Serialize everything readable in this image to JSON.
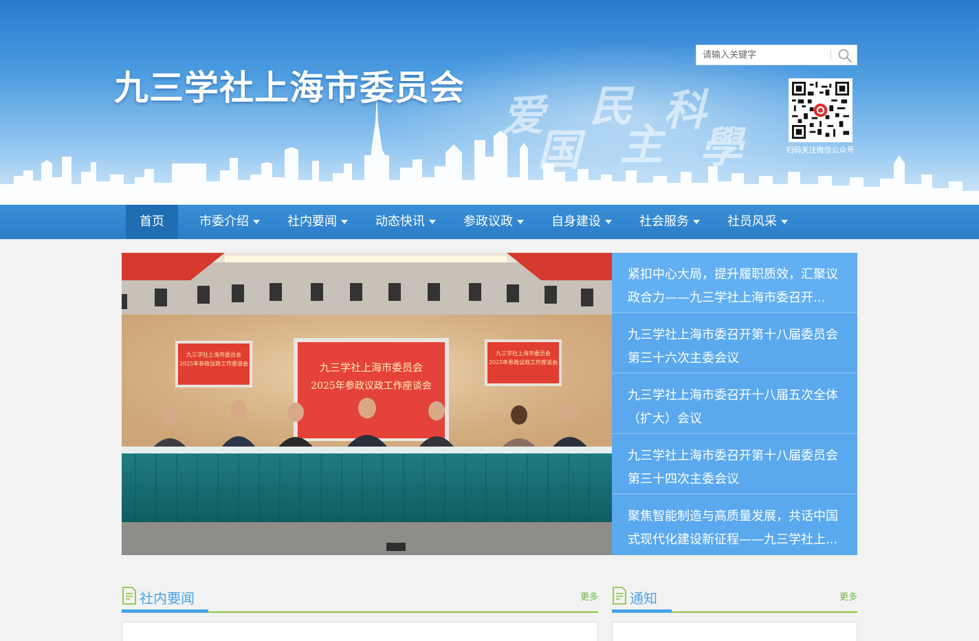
{
  "header": {
    "site_title": "九三学社上海市委员会",
    "slogan": [
      "爱",
      "国",
      "民",
      "主",
      "科",
      "學"
    ],
    "search_placeholder": "请输入关键字",
    "qr_caption": "扫码关注微信公众号"
  },
  "nav": {
    "items": [
      {
        "label": "首页",
        "active": true,
        "dropdown": false
      },
      {
        "label": "市委介绍",
        "dropdown": true
      },
      {
        "label": "社内要闻",
        "dropdown": true
      },
      {
        "label": "动态快讯",
        "dropdown": true
      },
      {
        "label": "参政议政",
        "dropdown": true
      },
      {
        "label": "自身建设",
        "dropdown": true
      },
      {
        "label": "社会服务",
        "dropdown": true
      },
      {
        "label": "社员风采",
        "dropdown": true
      }
    ]
  },
  "hero": {
    "photo": {
      "side_banner_left": [
        "九三学社上海市委员会",
        "2025年参政议政工作座谈会"
      ],
      "center_banner": [
        "九三学社上海市委员会",
        "2025年参政议政工作座谈会"
      ],
      "side_banner_right": [
        "九三学社上海市委员会",
        "2025年参政议政工作座谈会"
      ]
    },
    "news": [
      "紧扣中心大局，提升履职质效，汇聚议政合力——九三学社上海市委召开...",
      "九三学社上海市委召开第十八届委员会第三十六次主委会议",
      "九三学社上海市委召开十八届五次全体（扩大）会议",
      "九三学社上海市委召开第十八届委员会第三十四次主委会议",
      "聚焦智能制造与高质量发展，共话中国式现代化建设新征程——九三学社上..."
    ]
  },
  "sections": {
    "left": {
      "title": "社内要闻",
      "more": "更多"
    },
    "right": {
      "title": "通知",
      "more": "更多"
    }
  },
  "colors": {
    "nav_bg": "#2a7ec9",
    "nav_active": "#1f6db3",
    "hero_list_bg": "#5aa9ef",
    "section_title": "#4aa4e8",
    "more_link": "#74b84a"
  }
}
